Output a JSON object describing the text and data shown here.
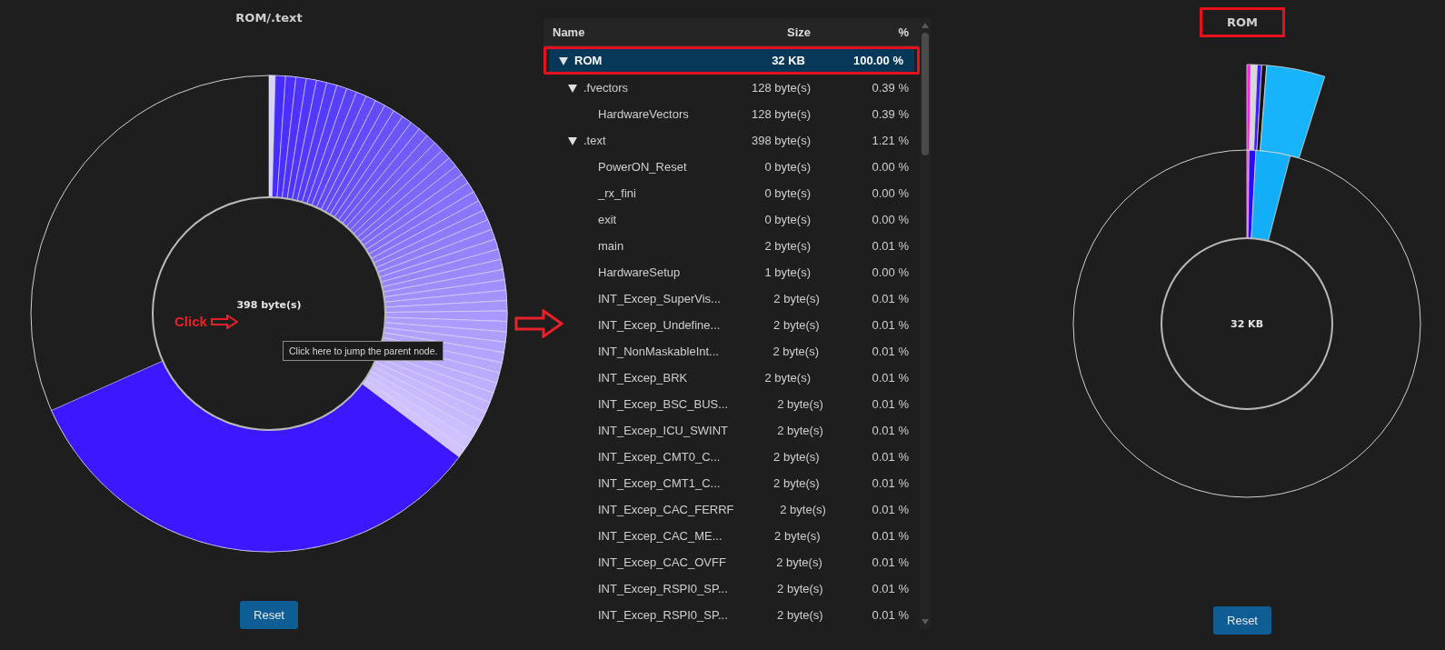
{
  "left_chart": {
    "title": "ROM/.text",
    "center_label": "398 byte(s)",
    "tooltip": "Click here to jump the parent node.",
    "reset_button": "Reset"
  },
  "annotation": {
    "label": "Click"
  },
  "tree": {
    "columns": [
      "Name",
      "Size",
      "%"
    ],
    "rows": [
      {
        "name": "ROM",
        "size": "32 KB",
        "percent": "100.00 %",
        "selected": true,
        "expanded": true,
        "children": [
          {
            "name": ".fvectors",
            "size": "128 byte(s)",
            "percent": "0.39 %",
            "selected": false,
            "expanded": true,
            "children": [
              {
                "name": "HardwareVectors",
                "size": "128 byte(s)",
                "percent": "0.39 %",
                "selected": false
              }
            ]
          },
          {
            "name": ".text",
            "size": "398 byte(s)",
            "percent": "1.21 %",
            "selected": false,
            "expanded": true,
            "children": [
              {
                "name": "PowerON_Reset",
                "size": "0 byte(s)",
                "percent": "0.00 %",
                "selected": false
              },
              {
                "name": "_rx_fini",
                "size": "0 byte(s)",
                "percent": "0.00 %",
                "selected": false
              },
              {
                "name": "exit",
                "size": "0 byte(s)",
                "percent": "0.00 %",
                "selected": false
              },
              {
                "name": "main",
                "size": "2 byte(s)",
                "percent": "0.01 %",
                "selected": false
              },
              {
                "name": "HardwareSetup",
                "size": "1 byte(s)",
                "percent": "0.00 %",
                "selected": false
              },
              {
                "name": "INT_Excep_SuperVis...",
                "size": "2 byte(s)",
                "percent": "0.01 %",
                "selected": false
              },
              {
                "name": "INT_Excep_Undefine...",
                "size": "2 byte(s)",
                "percent": "0.01 %",
                "selected": false
              },
              {
                "name": "INT_NonMaskableInt...",
                "size": "2 byte(s)",
                "percent": "0.01 %",
                "selected": false
              },
              {
                "name": "INT_Excep_BRK",
                "size": "2 byte(s)",
                "percent": "0.01 %",
                "selected": false
              },
              {
                "name": "INT_Excep_BSC_BUS...",
                "size": "2 byte(s)",
                "percent": "0.01 %",
                "selected": false
              },
              {
                "name": "INT_Excep_ICU_SWINT",
                "size": "2 byte(s)",
                "percent": "0.01 %",
                "selected": false
              },
              {
                "name": "INT_Excep_CMT0_C...",
                "size": "2 byte(s)",
                "percent": "0.01 %",
                "selected": false
              },
              {
                "name": "INT_Excep_CMT1_C...",
                "size": "2 byte(s)",
                "percent": "0.01 %",
                "selected": false
              },
              {
                "name": "INT_Excep_CAC_FERRF",
                "size": "2 byte(s)",
                "percent": "0.01 %",
                "selected": false
              },
              {
                "name": "INT_Excep_CAC_ME...",
                "size": "2 byte(s)",
                "percent": "0.01 %",
                "selected": false
              },
              {
                "name": "INT_Excep_CAC_OVFF",
                "size": "2 byte(s)",
                "percent": "0.01 %",
                "selected": false
              },
              {
                "name": "INT_Excep_RSPI0_SP...",
                "size": "2 byte(s)",
                "percent": "0.01 %",
                "selected": false
              },
              {
                "name": "INT_Excep_RSPI0_SP...",
                "size": "2 byte(s)",
                "percent": "0.01 %",
                "selected": false
              }
            ]
          }
        ]
      }
    ]
  },
  "right_chart": {
    "title": "ROM",
    "center_label": "32 KB",
    "reset_button": "Reset"
  }
}
